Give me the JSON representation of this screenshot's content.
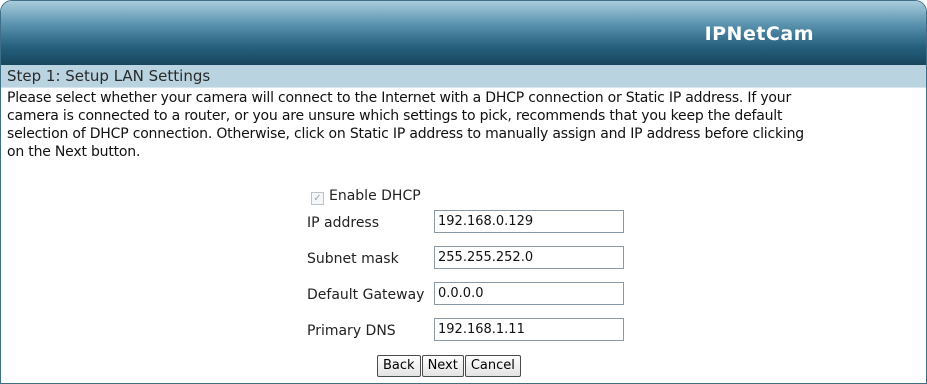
{
  "header": {
    "brand": "IPNetCam"
  },
  "step": {
    "title": "Step 1: Setup LAN Settings"
  },
  "description": [
    "Please select whether your camera will connect to the Internet with a DHCP connection or Static IP address. If your",
    "camera is connected to a router, or you are unsure which settings to pick, recommends that you keep the default",
    "selection of DHCP connection. Otherwise, click on Static IP address to manually assign and IP address before clicking",
    "on the Next button."
  ],
  "dhcp": {
    "label": "Enable DHCP",
    "checked": true
  },
  "fields": [
    {
      "label": "IP address",
      "value": "192.168.0.129"
    },
    {
      "label": "Subnet mask",
      "value": "255.255.252.0"
    },
    {
      "label": "Default Gateway",
      "value": "0.0.0.0"
    },
    {
      "label": "Primary DNS",
      "value": "192.168.1.11"
    }
  ],
  "buttons": {
    "back": "Back",
    "next": "Next",
    "cancel": "Cancel"
  }
}
